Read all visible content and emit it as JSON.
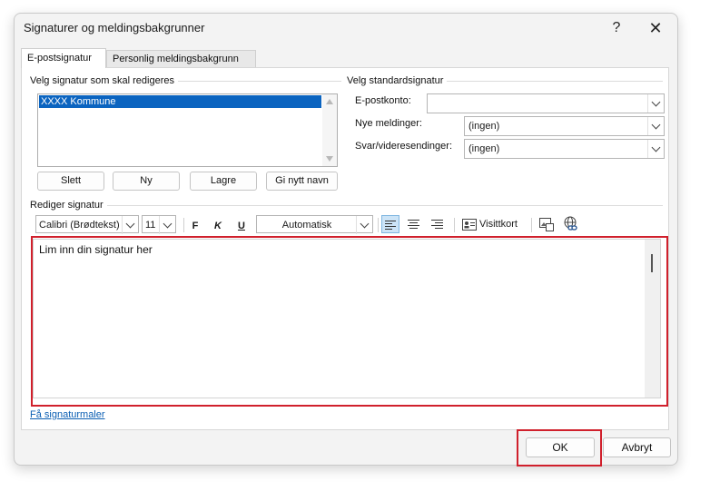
{
  "window": {
    "title": "Signaturer og meldingsbakgrunner",
    "help_label": "?",
    "close_label": "✕"
  },
  "tabs": [
    {
      "label": "E-postsignatur",
      "active": true
    },
    {
      "label": "Personlig meldingsbakgrunn",
      "active": false
    }
  ],
  "select_signature": {
    "label": "Velg signatur som skal redigeres",
    "items": [
      "XXXX Kommune"
    ],
    "selected": "XXXX Kommune"
  },
  "signature_buttons": {
    "delete": "Slett",
    "new": "Ny",
    "save": "Lagre",
    "rename": "Gi nytt navn"
  },
  "default_signature": {
    "label": "Velg standardsignatur",
    "account_label": "E-postkonto:",
    "account_value": "",
    "new_messages_label": "Nye meldinger:",
    "new_messages_value": "(ingen)",
    "replies_label": "Svar/videresendinger:",
    "replies_value": "(ingen)"
  },
  "edit_signature": {
    "label": "Rediger signatur",
    "font": "Calibri (Brødtekst)",
    "size": "11",
    "bold": "F",
    "italic": "K",
    "underline": "U",
    "color": "Automatisk",
    "business_card": "Visittkort",
    "content": "Lim inn din signatur her"
  },
  "link": "Få signaturmaler",
  "footer": {
    "ok": "OK",
    "cancel": "Avbryt"
  },
  "colors": {
    "highlight_frame": "#d0202c",
    "selection": "#0b64c0",
    "link": "#0b5fb3"
  }
}
